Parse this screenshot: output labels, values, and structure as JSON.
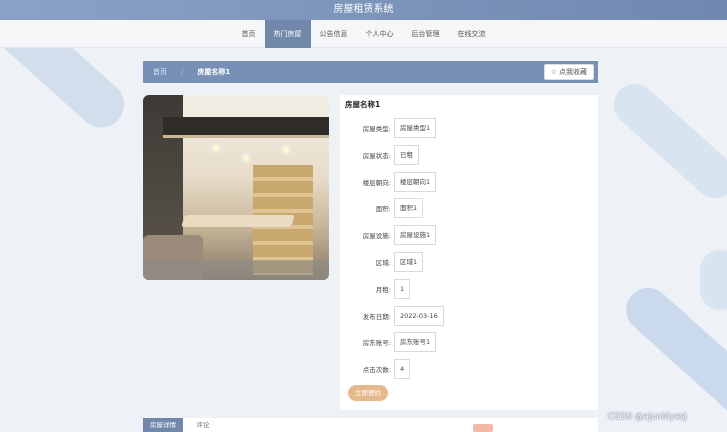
{
  "app": {
    "title": "房屋租赁系统"
  },
  "nav": {
    "items": [
      {
        "label": "首页",
        "active": false
      },
      {
        "label": "热门房屋",
        "active": true
      },
      {
        "label": "公告信息",
        "active": false
      },
      {
        "label": "个人中心",
        "active": false
      },
      {
        "label": "后台管理",
        "active": false
      },
      {
        "label": "在线交流",
        "active": false
      }
    ]
  },
  "breadcrumb": {
    "home": "首页",
    "current": "房屋名称1"
  },
  "favorite": {
    "label": "点我收藏",
    "icon": "star-icon"
  },
  "detail": {
    "title": "房屋名称1",
    "fields": [
      {
        "label": "房屋类型:",
        "value": "房屋类型1"
      },
      {
        "label": "房屋状态:",
        "value": "已租"
      },
      {
        "label": "楼层朝向:",
        "value": "楼层朝向1"
      },
      {
        "label": "面积:",
        "value": "面积1"
      },
      {
        "label": "房屋设施:",
        "value": "房屋设施1"
      },
      {
        "label": "区域:",
        "value": "区域1"
      },
      {
        "label": "月租:",
        "value": "1"
      },
      {
        "label": "发布日期:",
        "value": "2022-03-16"
      },
      {
        "label": "房东账号:",
        "value": "房东账号1"
      },
      {
        "label": "点击次数:",
        "value": "4"
      }
    ],
    "book_label": "立即预约"
  },
  "tabs": [
    {
      "label": "房屋详情",
      "active": true
    },
    {
      "label": "评论",
      "active": false
    }
  ],
  "watermark": "CSDN @ajunbiyesj",
  "colors": {
    "accent": "#7188ab",
    "book": "#e6b98c"
  }
}
